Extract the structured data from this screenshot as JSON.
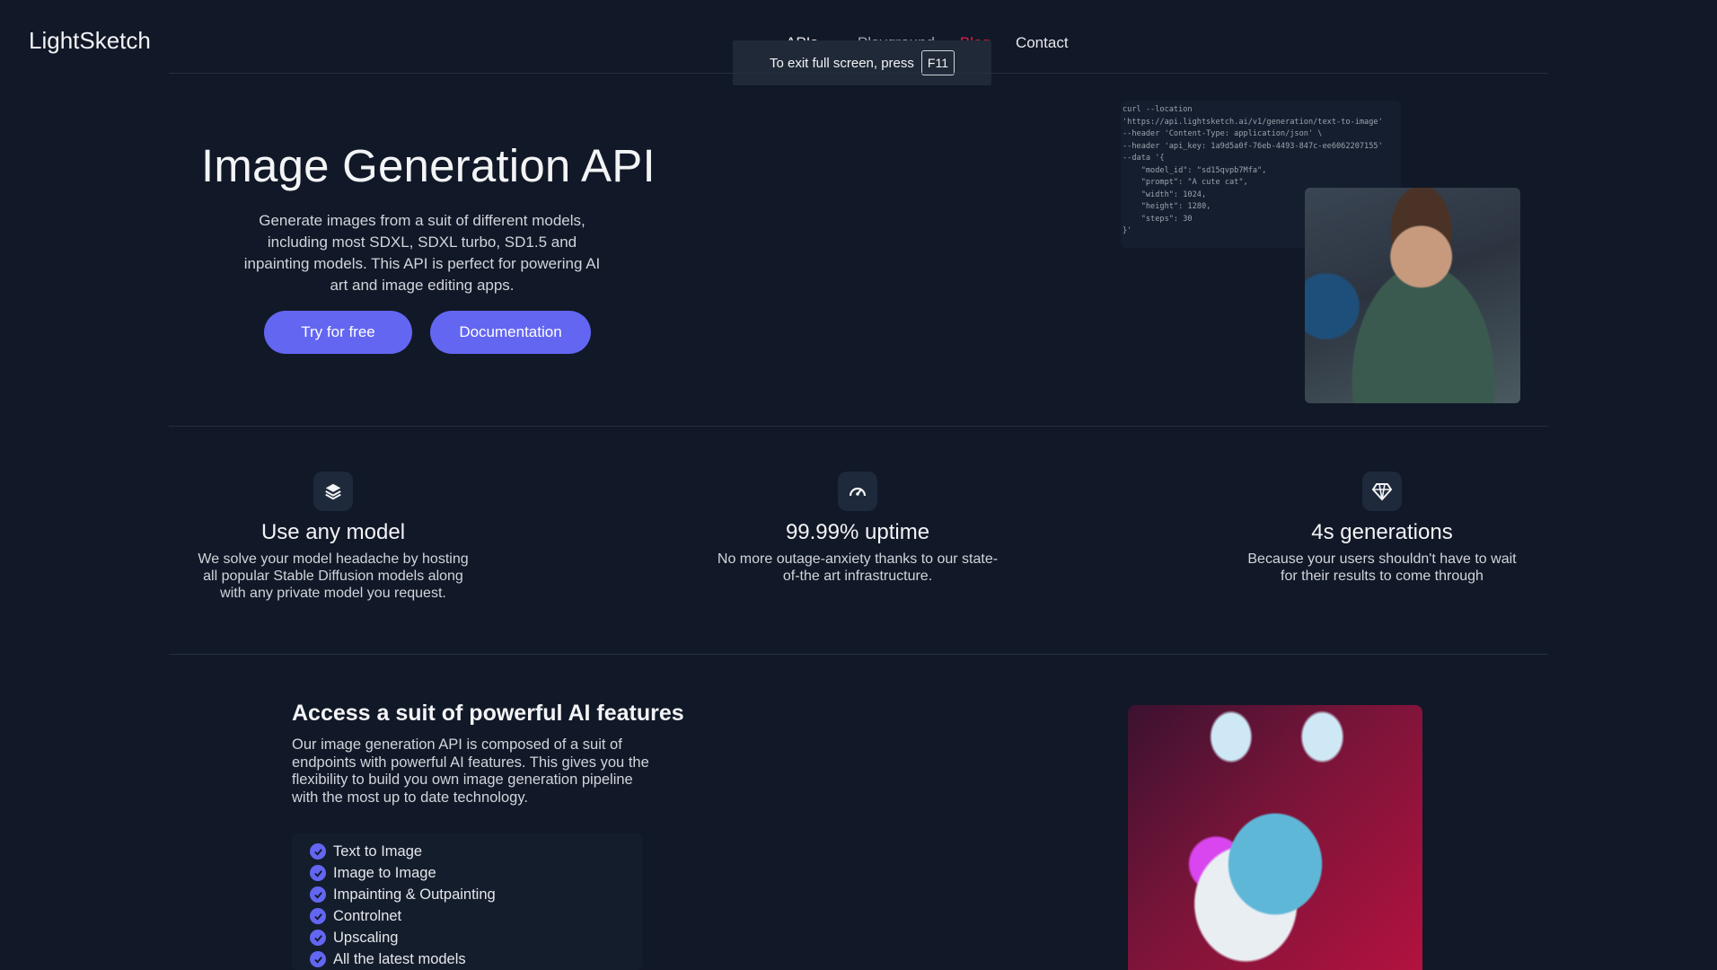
{
  "nav": {
    "logo": "LightSketch",
    "apis": "APIs",
    "playground": "Playground",
    "blog": "Blog",
    "contact": "Contact"
  },
  "fullscreen_toast": {
    "text": "To exit full screen, press",
    "key": "F11"
  },
  "hero": {
    "title": "Image Generation API",
    "description": "Generate images from a suit of different models, including most SDXL, SDXL turbo, SD1.5 and inpainting models. This API is perfect for powering AI art and image editing apps.",
    "try_label": "Try for free",
    "docs_label": "Documentation",
    "code_lines": [
      "curl --location",
      "'https://api.lightsketch.ai/v1/generation/text-to-image'",
      "--header 'Content-Type: application/json' \\",
      "--header 'api_key: 1a9d5a0f-76eb-4493-847c-ee6062207155'",
      "--data '{",
      "    \"model_id\": \"sd15qvpb7Mfa\",",
      "    \"prompt\": \"A cute cat\",",
      "    \"width\": 1024,",
      "    \"height\": 1280,",
      "    \"steps\": 30",
      "}'"
    ]
  },
  "features": [
    {
      "icon": "layers-icon",
      "title": "Use any model",
      "text": "We solve your model headache by hosting all popular Stable Diffusion models along with any private model you request."
    },
    {
      "icon": "gauge-icon",
      "title": "99.99% uptime",
      "text": "No more outage-anxiety thanks to our state-of-the art infrastructure."
    },
    {
      "icon": "diamond-icon",
      "title": "4s generations",
      "text": "Because your users shouldn't have to wait for their results to come through"
    }
  ],
  "access": {
    "title": "Access a suit of powerful AI features",
    "text": "Our image generation API is composed of a suit of endpoints with powerful AI features. This gives you the flexibility to build you own image generation pipeline with the most up to date technology.",
    "items": [
      "Text to Image",
      "Image to Image",
      "Impainting & Outpainting",
      "Controlnet",
      "Upscaling",
      "All the latest models"
    ]
  },
  "colors": {
    "background": "#111827",
    "accent": "#6366f1",
    "blog": "#e11d48"
  }
}
